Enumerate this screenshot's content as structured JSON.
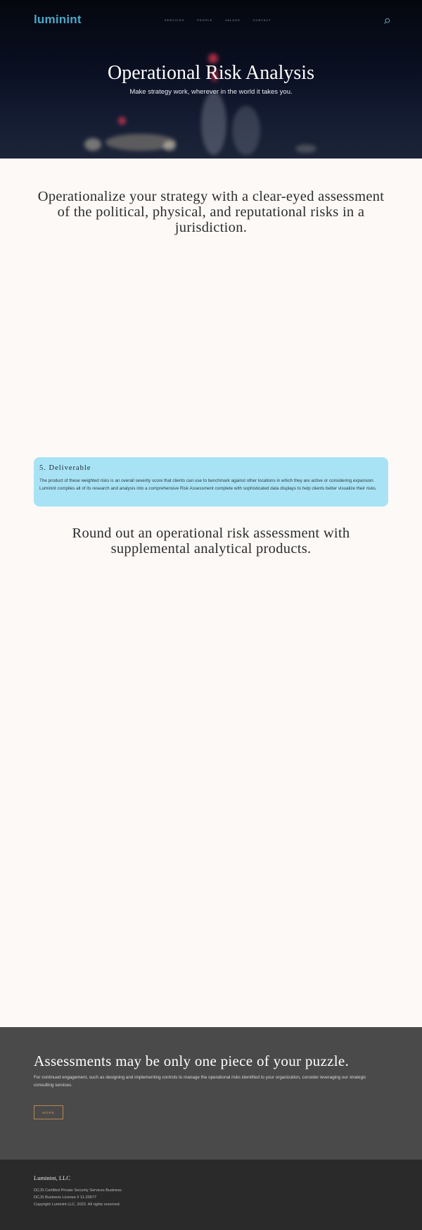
{
  "header": {
    "logo": "luminint",
    "nav": [
      "SERVICES",
      "PEOPLE",
      "VALUES",
      "CONTACT"
    ],
    "search_icon": "search-icon"
  },
  "hero": {
    "title": "Operational Risk Analysis",
    "subtitle": "Make strategy work, wherever in the world it takes you."
  },
  "intro": {
    "heading": "Operationalize your strategy with a clear-eyed assessment of the political, physical, and reputational risks in a jurisdiction."
  },
  "deliverable": {
    "title": "5. Deliverable",
    "body": "The product of these weighted risks is an overall severity score that clients can use to benchmark against other locations in which they are active or considering expansion. Luminint compiles all of its research and analysis into a comprehensive Risk Assessment complete with sophisticated data displays to help clients better visualize their risks."
  },
  "supplemental": {
    "heading": "Round out an operational risk assessment with supplemental analytical products."
  },
  "cta": {
    "title": "Assessments may be only one piece of your puzzle.",
    "body": "For continued engagement, such as designing and implementing controls to manage the operational risks identified to your organization, consider leveraging our strategic consulting services.",
    "button": "MORE",
    "accent": "#b8874f"
  },
  "footer": {
    "company": "Luminint, LLC",
    "line1": "DCJS Certified Private Security Services Business",
    "line2": "DCJS Business License # 11-20077",
    "line3": "Copyright Luminint LLC, 2022. All rights reserved."
  },
  "colors": {
    "brand": "#4aa8c9",
    "card_bg": "#a8e3f5",
    "page_bg": "#fcf9f7",
    "cta_bg": "#4a4a4a",
    "footer_bg": "#2a2a2a"
  }
}
